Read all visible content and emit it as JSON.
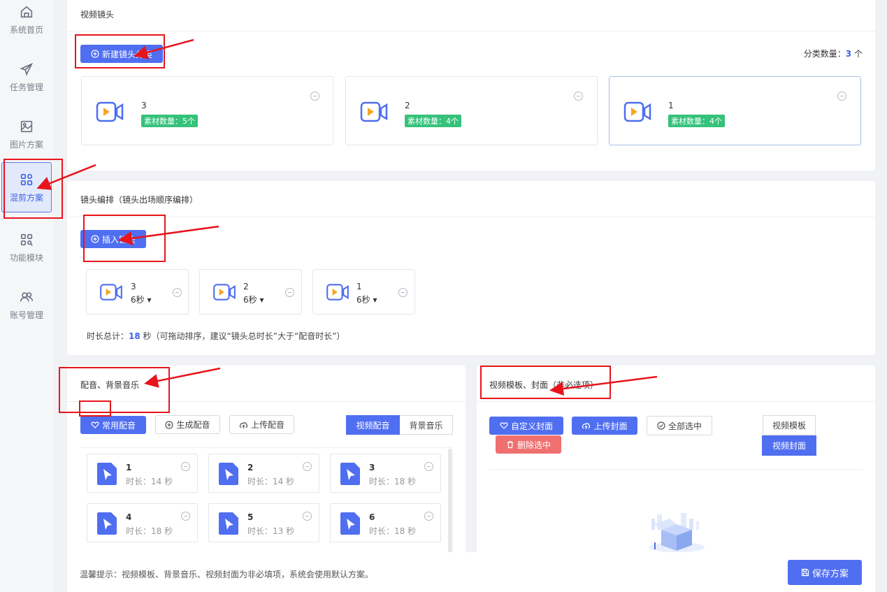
{
  "sidebar": {
    "items": [
      {
        "label": "系统首页",
        "icon": "home-icon"
      },
      {
        "label": "任务管理",
        "icon": "paper-plane-icon"
      },
      {
        "label": "图片方案",
        "icon": "image-icon"
      },
      {
        "label": "混剪方案",
        "icon": "grid-apps-icon"
      },
      {
        "label": "功能模块",
        "icon": "grid-search-icon"
      },
      {
        "label": "账号管理",
        "icon": "users-icon"
      }
    ],
    "active_index": 3
  },
  "shots_section": {
    "title": "视频镜头",
    "new_button": "新建镜头分类",
    "count_label": "分类数量：",
    "count_value": "3",
    "count_unit": "个",
    "cards": [
      {
        "name": "3",
        "tag": "素材数量：5个"
      },
      {
        "name": "2",
        "tag": "素材数量：4个"
      },
      {
        "name": "1",
        "tag": "素材数量：4个"
      }
    ]
  },
  "sequence_section": {
    "title": "镜头编排（镜头出场顺序编排）",
    "insert_button": "插入镜头",
    "items": [
      {
        "name": "3",
        "duration": "6秒 ▾"
      },
      {
        "name": "2",
        "duration": "6秒 ▾"
      },
      {
        "name": "1",
        "duration": "6秒 ▾"
      }
    ],
    "total_label": "时长总计：",
    "total_value": "18",
    "total_suffix": "秒（可拖动排序，建议“镜头总时长”大于“配音时长”）"
  },
  "audio_section": {
    "title": "配音、背景音乐",
    "common_button": "常用配音",
    "generate_button": "生成配音",
    "upload_button": "上传配音",
    "tabs": [
      "视频配音",
      "背景音乐"
    ],
    "active_tab": 0,
    "items": [
      {
        "name": "1",
        "duration": "时长：14 秒"
      },
      {
        "name": "2",
        "duration": "时长：14 秒"
      },
      {
        "name": "3",
        "duration": "时长：18 秒"
      },
      {
        "name": "4",
        "duration": "时长：18 秒"
      },
      {
        "name": "5",
        "duration": "时长：13 秒"
      },
      {
        "name": "6",
        "duration": "时长：18 秒"
      }
    ]
  },
  "cover_section": {
    "title": "视频模板、封面（非必选项）",
    "custom_button": "自定义封面",
    "upload_button": "上传封面",
    "select_all_button": "全部选中",
    "delete_button": "删除选中",
    "tabs": [
      "视频模板",
      "视频封面"
    ],
    "active_tab": 1
  },
  "footer": {
    "tip": "温馨提示：视频模板、背景音乐、视频封面为非必填项，系统会使用默认方案。",
    "save_button": "保存方案"
  },
  "colors": {
    "primary": "#4f6ef0",
    "success_tag": "#35c27a",
    "danger": "#f07070",
    "annotation": "#e8141c"
  }
}
